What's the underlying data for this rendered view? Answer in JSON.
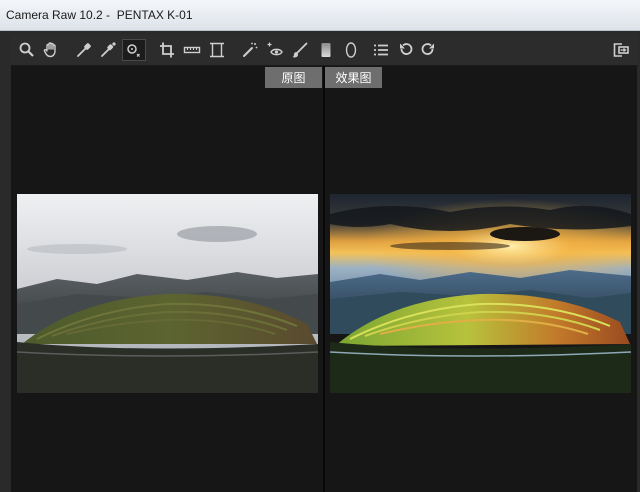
{
  "window": {
    "title": "Camera Raw 10.2 -  PENTAX K-01"
  },
  "toolbar": {
    "tools": [
      {
        "name": "zoom-tool",
        "icon": "magnifier-icon"
      },
      {
        "name": "hand-tool",
        "icon": "hand-icon"
      },
      {
        "name": "white-balance-tool",
        "icon": "eyedropper-icon"
      },
      {
        "name": "color-sampler-tool",
        "icon": "color-sampler-icon"
      },
      {
        "name": "targeted-adjustment-tool",
        "icon": "target-adjust-icon",
        "active": true
      },
      {
        "name": "crop-tool",
        "icon": "crop-icon"
      },
      {
        "name": "straighten-tool",
        "icon": "ruler-icon"
      },
      {
        "name": "transform-tool",
        "icon": "transform-icon"
      },
      {
        "name": "spot-removal-tool",
        "icon": "spot-removal-icon"
      },
      {
        "name": "red-eye-tool",
        "icon": "red-eye-icon"
      },
      {
        "name": "adjustment-brush-tool",
        "icon": "brush-icon"
      },
      {
        "name": "graduated-filter-tool",
        "icon": "graduated-filter-icon"
      },
      {
        "name": "radial-filter-tool",
        "icon": "radial-filter-icon"
      },
      {
        "name": "preferences-tool",
        "icon": "list-icon"
      },
      {
        "name": "rotate-ccw-tool",
        "icon": "rotate-ccw-icon"
      },
      {
        "name": "rotate-cw-tool",
        "icon": "rotate-cw-icon"
      },
      {
        "name": "fullscreen-toggle",
        "icon": "fullscreen-icon"
      }
    ]
  },
  "preview": {
    "before_label": "原图",
    "after_label": "效果图"
  },
  "colors": {
    "title_bar": "#e6ebf0",
    "workspace": "#2a2a2a",
    "panel": "#161616",
    "label_chip": "#6e6e6e"
  }
}
